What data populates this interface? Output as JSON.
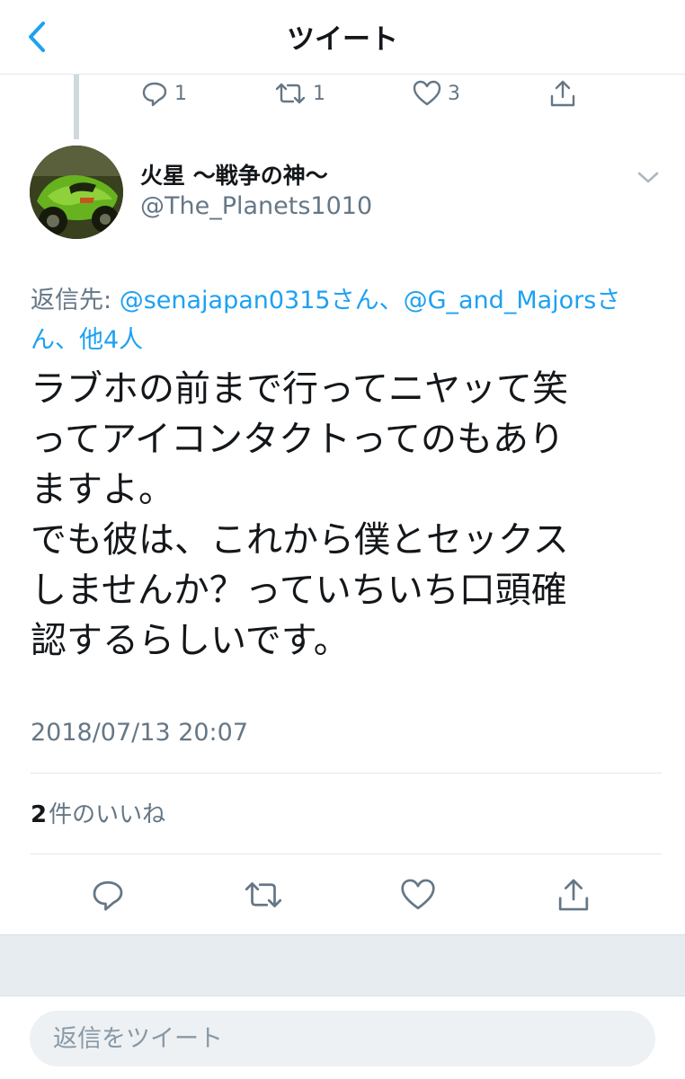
{
  "header": {
    "title": "ツイート"
  },
  "previous_tweet_actions": {
    "reply_count": "1",
    "retweet_count": "1",
    "like_count": "3"
  },
  "tweet": {
    "display_name": "火星 〜戦争の神〜",
    "handle": "@The_Planets1010",
    "reply_to": {
      "prefix": "返信先: ",
      "mention1": "@senajapan0315",
      "sep1": "さん、",
      "mention2": "@G_and_Majors",
      "sep2": "さん、",
      "others": "他4人"
    },
    "text": "ラブホの前まで行ってニヤッて笑\nってアイコンタクトってのもあり\nますよ。\nでも彼は、これから僕とセックス\nしませんか？っていちいち口頭確\n認するらしいです。",
    "timestamp": "2018/07/13 20:07",
    "like_count": "2",
    "like_label": "件のいいね"
  },
  "reply_bar": {
    "placeholder": "返信をツイート"
  },
  "colors": {
    "accent": "#1da1f2",
    "secondary_text": "#657786",
    "divider": "#e1e8ed",
    "band": "#e6ecf0"
  },
  "icons": [
    "back-chevron-icon",
    "reply-icon",
    "retweet-icon",
    "like-icon",
    "share-icon",
    "chevron-down-icon"
  ]
}
